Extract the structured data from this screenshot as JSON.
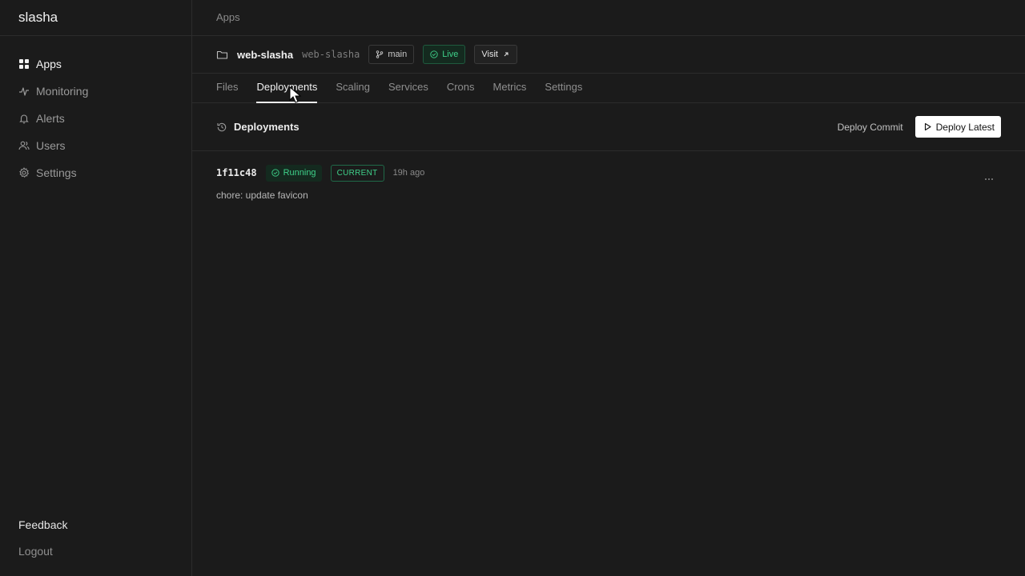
{
  "brand": "slasha",
  "sidebar": {
    "items": [
      {
        "label": "Apps",
        "icon": "grid-icon"
      },
      {
        "label": "Monitoring",
        "icon": "pulse-icon"
      },
      {
        "label": "Alerts",
        "icon": "bell-icon"
      },
      {
        "label": "Users",
        "icon": "users-icon"
      },
      {
        "label": "Settings",
        "icon": "gear-icon"
      }
    ],
    "feedback": "Feedback",
    "logout": "Logout"
  },
  "breadcrumb": "Apps",
  "app": {
    "name": "web-slasha",
    "slug": "web-slasha",
    "branch": "main",
    "status": "Live",
    "visit_label": "Visit"
  },
  "tabs": [
    {
      "label": "Files"
    },
    {
      "label": "Deployments"
    },
    {
      "label": "Scaling"
    },
    {
      "label": "Services"
    },
    {
      "label": "Crons"
    },
    {
      "label": "Metrics"
    },
    {
      "label": "Settings"
    }
  ],
  "deployments": {
    "title": "Deployments",
    "deploy_commit_label": "Deploy Commit",
    "deploy_latest_label": "Deploy Latest",
    "rows": [
      {
        "commit": "1f11c48",
        "status": "Running",
        "badge": "CURRENT",
        "time": "19h ago",
        "message": "chore: update favicon"
      }
    ]
  },
  "colors": {
    "background": "#1b1b1b",
    "accent_green": "#3fd18a",
    "border": "#2c2c2c"
  }
}
